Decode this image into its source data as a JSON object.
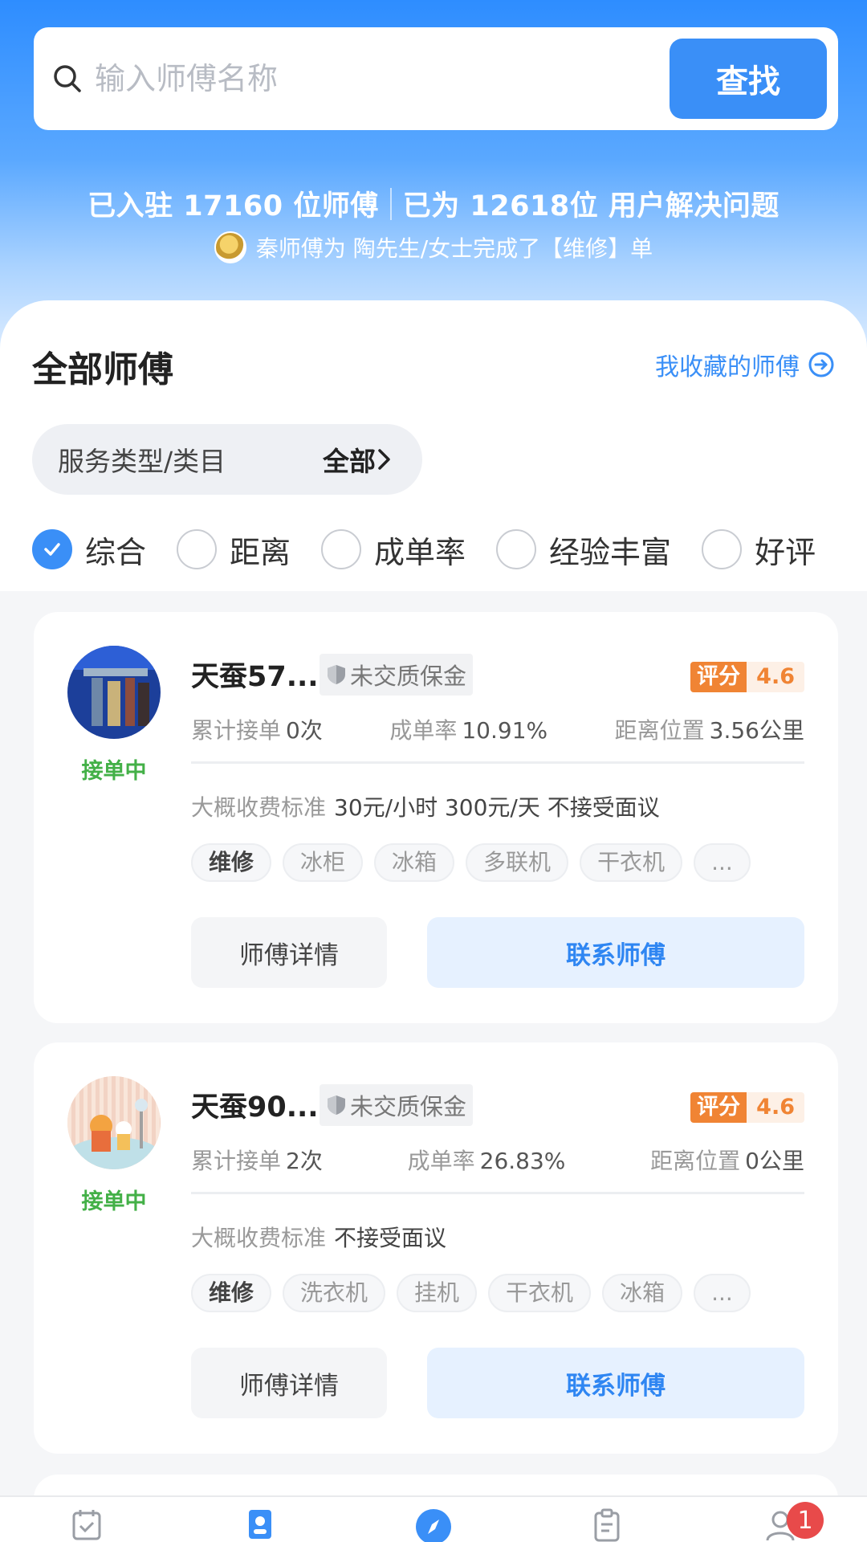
{
  "search": {
    "placeholder": "输入师傅名称",
    "button_label": "查找"
  },
  "stats": {
    "part1": "已入驻 17160 位师傅",
    "part2": "已为 12618位  用户解决问题"
  },
  "ticker": {
    "text": "秦师傅为 陶先生/女士完成了【维修】单"
  },
  "section": {
    "title": "全部师傅",
    "favorites_link": "我收藏的师傅"
  },
  "filter": {
    "label": "服务类型/类目",
    "value": "全部"
  },
  "sort_options": [
    {
      "label": "综合",
      "checked": true
    },
    {
      "label": "距离",
      "checked": false
    },
    {
      "label": "成单率",
      "checked": false
    },
    {
      "label": "经验丰富",
      "checked": false
    },
    {
      "label": "好评",
      "checked": false
    }
  ],
  "masters": [
    {
      "name": "天蚕57...",
      "status": "接单中",
      "deposit": "未交质保金",
      "rating_label": "评分",
      "rating": "4.6",
      "orders_label": "累计接单",
      "orders": "0次",
      "rate_label": "成单率",
      "rate": "10.91%",
      "distance_label": "距离位置",
      "distance": "3.56公里",
      "price_label": "大概收费标准",
      "price": "30元/小时  300元/天  不接受面议",
      "tags": [
        "维修",
        "冰柜",
        "冰箱",
        "多联机",
        "干衣机",
        "..."
      ],
      "detail_button": "师傅详情",
      "contact_button": "联系师傅"
    },
    {
      "name": "天蚕90...",
      "status": "接单中",
      "deposit": "未交质保金",
      "rating_label": "评分",
      "rating": "4.6",
      "orders_label": "累计接单",
      "orders": "2次",
      "rate_label": "成单率",
      "rate": "26.83%",
      "distance_label": "距离位置",
      "distance": "0公里",
      "price_label": "大概收费标准",
      "price": "不接受面议",
      "tags": [
        "维修",
        "洗衣机",
        "挂机",
        "干衣机",
        "冰箱",
        "..."
      ],
      "detail_button": "师傅详情",
      "contact_button": "联系师傅"
    }
  ],
  "tabbar": {
    "badge_count": "1"
  },
  "colors": {
    "primary": "#3a8ff7",
    "status_green": "#43b047",
    "rating_orange": "#f08434"
  }
}
